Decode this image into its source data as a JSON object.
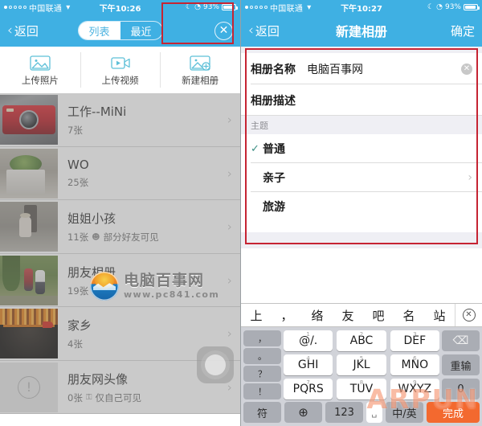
{
  "left": {
    "status": {
      "carrier": "中国联通",
      "wifi": "▾",
      "time": "下午10:26",
      "moon": "☾",
      "alarm": "◔",
      "battery": "93%"
    },
    "nav": {
      "back": "返回",
      "back_chevron": "‹",
      "close": "✕",
      "segments": [
        {
          "label": "列表",
          "active": true
        },
        {
          "label": "最近",
          "active": false
        }
      ]
    },
    "toolbar": [
      {
        "label": "上传照片",
        "icon": "photo-upload-icon",
        "highlighted": false
      },
      {
        "label": "上传视频",
        "icon": "video-upload-icon",
        "highlighted": false
      },
      {
        "label": "新建相册",
        "icon": "new-album-icon",
        "highlighted": true
      }
    ],
    "albums": [
      {
        "title": "工作--MiNi",
        "count": "7张",
        "privacy": "",
        "privacy_icon": "",
        "chevron": "›"
      },
      {
        "title": "WO",
        "count": "25张",
        "privacy": "",
        "privacy_icon": "",
        "chevron": "›"
      },
      {
        "title": "姐姐小孩",
        "count": "11张",
        "privacy": "部分好友可见",
        "privacy_icon": "☻",
        "chevron": "›"
      },
      {
        "title": "朋友相册",
        "count": "19张",
        "privacy": "",
        "privacy_icon": "",
        "chevron": "›"
      },
      {
        "title": "家乡",
        "count": "4张",
        "privacy": "",
        "privacy_icon": "",
        "chevron": "›"
      },
      {
        "title": "朋友网头像",
        "count": "0张",
        "privacy": "仅自己可见",
        "privacy_icon": "⚿",
        "chevron": "›"
      }
    ],
    "watermark": {
      "line1": "电脑百事网",
      "line2": "www.pc841.com"
    }
  },
  "right": {
    "status": {
      "carrier": "中国联通",
      "wifi": "▾",
      "time": "下午10:27",
      "moon": "☾",
      "alarm": "◔",
      "battery": "93%"
    },
    "nav": {
      "back": "返回",
      "back_chevron": "‹",
      "title": "新建相册",
      "confirm": "确定"
    },
    "form": {
      "name_label": "相册名称",
      "name_value": "电脑百事网",
      "clear_icon": "✕",
      "desc_label": "相册描述",
      "section_theme": "主题",
      "themes": [
        {
          "label": "普通",
          "checked": true,
          "check": "✓",
          "chevron": ""
        },
        {
          "label": "亲子",
          "checked": false,
          "check": "",
          "chevron": "›"
        },
        {
          "label": "旅游",
          "checked": false,
          "check": "",
          "chevron": ""
        }
      ]
    },
    "keyboard": {
      "candidates": [
        "上",
        "，",
        "络",
        "友",
        "吧",
        "名",
        "站"
      ],
      "candidate_close": "✕",
      "punct_column": [
        "，",
        "。",
        "？",
        "！"
      ],
      "keys": [
        {
          "num": "1",
          "label": "@/."
        },
        {
          "num": "2",
          "label": "ABC"
        },
        {
          "num": "3",
          "label": "DEF"
        },
        {
          "num": "4",
          "label": "GHI"
        },
        {
          "num": "5",
          "label": "JKL"
        },
        {
          "num": "6",
          "label": "MNO"
        },
        {
          "num": "7",
          "label": "PQRS"
        },
        {
          "num": "8",
          "label": "TUV"
        },
        {
          "num": "9",
          "label": "WXYZ"
        }
      ],
      "backspace_icon": "⌫",
      "redo_label": "重输",
      "zero_label": "0",
      "symbol_label": "符",
      "globe_icon": "⊕",
      "num_label": "123",
      "space_label": "␣",
      "lang_label": "中/英",
      "done_label": "完成"
    },
    "watermark": "ARPUN"
  },
  "colors": {
    "accent": "#3fb0e3",
    "highlight": "#c62433",
    "done": "#f3692f",
    "check": "#3c8f83"
  }
}
